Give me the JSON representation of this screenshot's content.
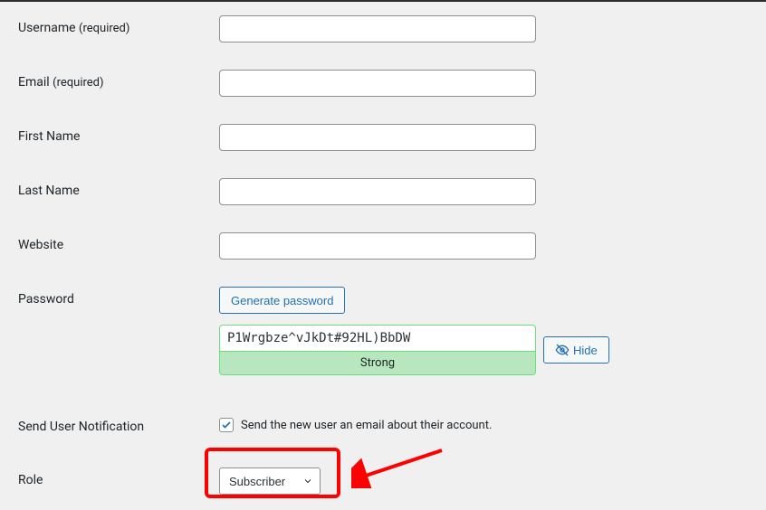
{
  "fields": {
    "username": {
      "label": "Username",
      "required_suffix": "(required)",
      "value": ""
    },
    "email": {
      "label": "Email",
      "required_suffix": "(required)",
      "value": ""
    },
    "first_name": {
      "label": "First Name",
      "value": ""
    },
    "last_name": {
      "label": "Last Name",
      "value": ""
    },
    "website": {
      "label": "Website",
      "value": ""
    },
    "password": {
      "label": "Password",
      "generate_button": "Generate password",
      "value": "P1Wrgbze^vJkDt#92HL)BbDW",
      "hide_button": "Hide",
      "strength": "Strong"
    },
    "notification": {
      "label": "Send User Notification",
      "checkbox_label": "Send the new user an email about their account.",
      "checked": true
    },
    "role": {
      "label": "Role",
      "selected": "Subscriber"
    }
  }
}
